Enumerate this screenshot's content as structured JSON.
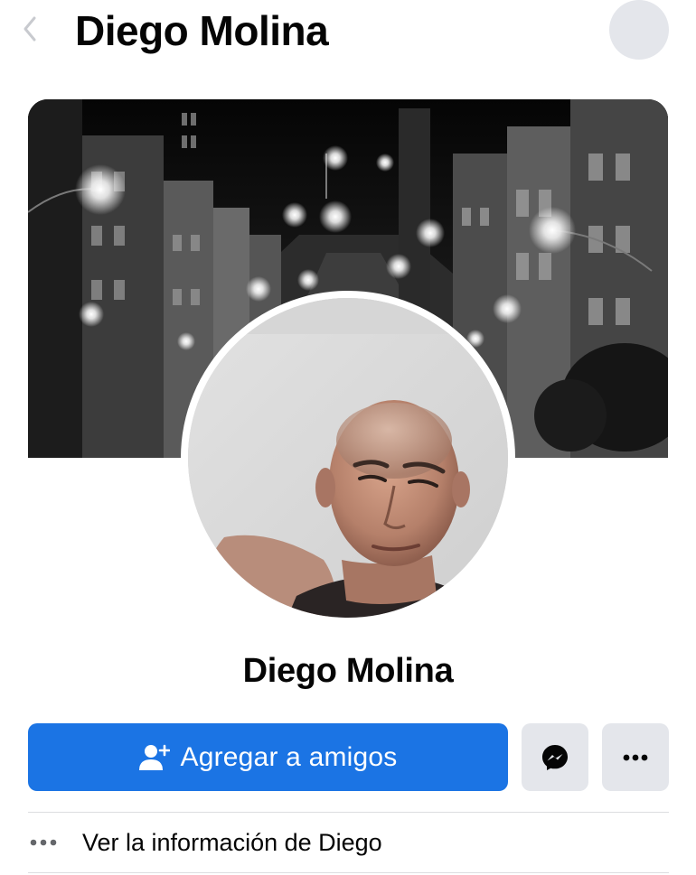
{
  "header": {
    "title": "Diego Molina",
    "back_icon": "chevron-left-icon",
    "search_icon": "search-icon"
  },
  "profile": {
    "name": "Diego Molina"
  },
  "actions": {
    "add_friend_label": "Agregar a amigos",
    "add_friend_icon": "add-friend-icon",
    "messenger_icon": "messenger-icon",
    "more_icon": "more-dots-icon"
  },
  "info": {
    "label": "Ver la información de Diego",
    "icon": "more-dots-icon"
  },
  "colors": {
    "primary": "#1b74e4",
    "secondary_bg": "#e4e6eb",
    "text": "#050505"
  }
}
